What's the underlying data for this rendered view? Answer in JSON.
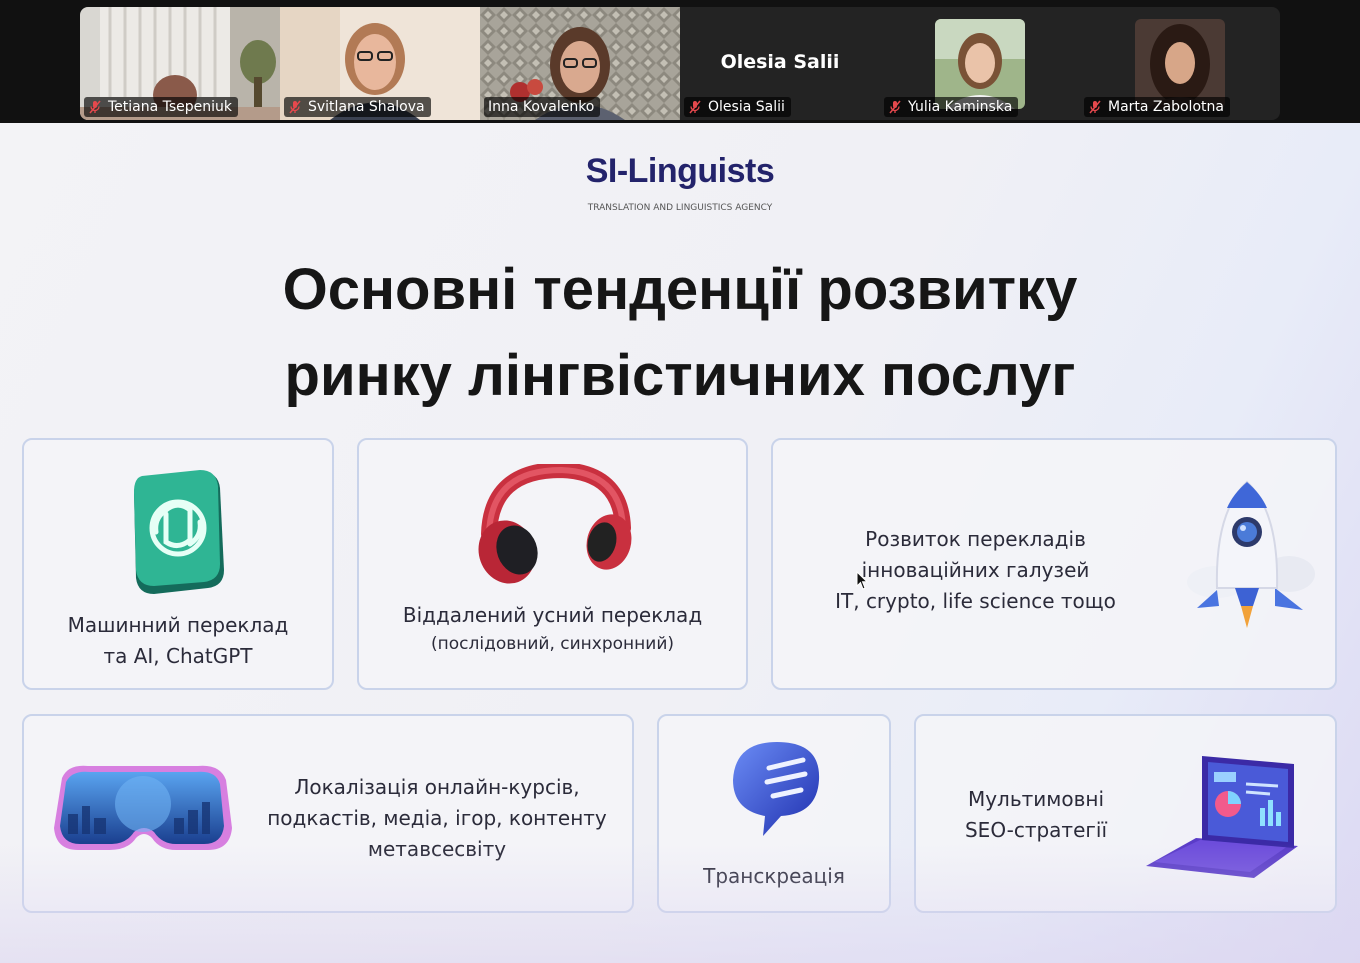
{
  "meeting": {
    "participants": [
      {
        "name": "Tetiana Tsepeniuk",
        "muted": true,
        "video": true
      },
      {
        "name": "Svitlana Shalova",
        "muted": true,
        "video": true
      },
      {
        "name": "Inna Kovalenko",
        "muted": false,
        "video": true,
        "active_speaker": true
      },
      {
        "name": "Olesia Salii",
        "muted": true,
        "video": false,
        "display_name": "Olesia Salii"
      },
      {
        "name": "Yulia Kaminska",
        "muted": true,
        "video": false,
        "avatar": true
      },
      {
        "name": "Marta Zabolotna",
        "muted": true,
        "video": false,
        "avatar": true
      }
    ],
    "colors": {
      "active_border": "#2de38a",
      "muted_icon": "#e5484d"
    }
  },
  "slide": {
    "brand": "SI-Linguists",
    "tagline": "TRANSLATION AND LINGUISTICS AGENCY",
    "headline_line1": "Основні тенденції розвитку",
    "headline_line2": "ринку лінгвістичних послуг",
    "cards": [
      {
        "lines": [
          "Машинний переклад",
          "та AI, ChatGPT"
        ],
        "icon": "chatgpt-logo-icon"
      },
      {
        "lines": [
          "Віддалений усний переклад",
          "(послідовний, синхронний)"
        ],
        "icon": "headphones-icon"
      },
      {
        "lines": [
          "Розвиток перекладів",
          "інноваційних галузей",
          "IT, crypto, life science тощо"
        ],
        "icon": "rocket-icon"
      },
      {
        "lines": [
          "Локалізація онлайн-курсів,",
          "подкастів, медіа, ігор, контенту",
          "метавсесвіту"
        ],
        "icon": "vr-headset-icon"
      },
      {
        "lines": [
          "Транскреація"
        ],
        "icon": "chat-bubble-icon"
      },
      {
        "lines": [
          "Мультимовні",
          "SEO-стратегії"
        ],
        "icon": "laptop-analytics-icon"
      }
    ],
    "colors": {
      "brand": "#23236b",
      "card_border": "#c9d3ea",
      "accent_teal": "#1f9b83",
      "accent_red": "#d6384a",
      "accent_blue": "#3b5bd8",
      "accent_purple": "#6a4ad8"
    }
  }
}
